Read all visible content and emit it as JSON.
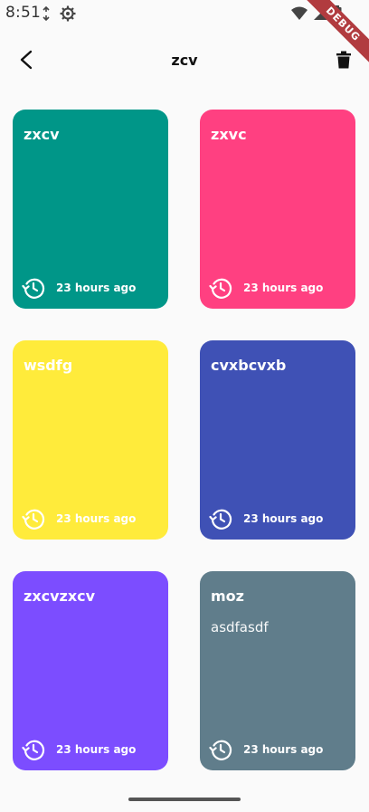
{
  "status_bar": {
    "time": "8:51",
    "left_icons": [
      "data-saver-icon",
      "settings-icon"
    ],
    "right_icons": [
      "wifi-icon",
      "signal-icon",
      "battery-icon"
    ],
    "debug_banner": "DEBUG"
  },
  "app_bar": {
    "title": "zcv",
    "back_icon": "arrow-back-icon",
    "delete_icon": "trash-icon"
  },
  "notes": [
    {
      "title": "zxcv",
      "body": "",
      "time": "23 hours ago",
      "color": "#009688"
    },
    {
      "title": "zxvc",
      "body": "",
      "time": "23 hours ago",
      "color": "#FF4081"
    },
    {
      "title": "wsdfg",
      "body": "",
      "time": "23 hours ago",
      "color": "#FFEB3B"
    },
    {
      "title": "cvxbcvxb",
      "body": "",
      "time": "23 hours ago",
      "color": "#3F51B5"
    },
    {
      "title": "zxcvzxcv",
      "body": "",
      "time": "23 hours ago",
      "color": "#7C4DFF"
    },
    {
      "title": "moz",
      "body": "asdfasdf",
      "time": "23 hours ago",
      "color": "#607D8B"
    }
  ]
}
